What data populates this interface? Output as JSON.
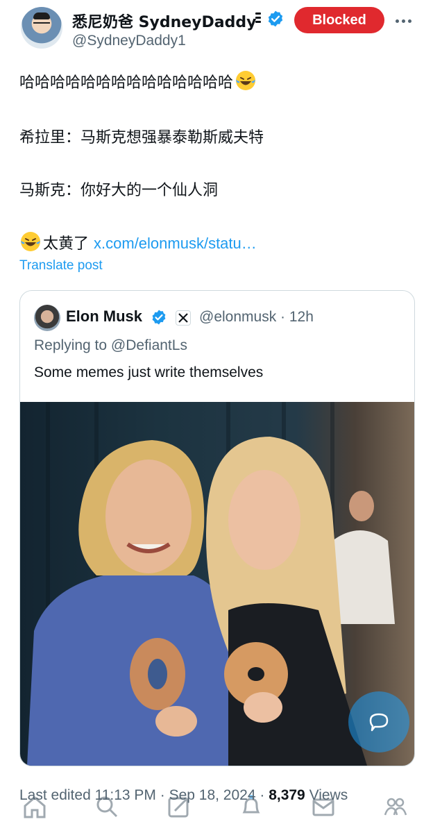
{
  "author": {
    "display_name": "悉尼奶爸 SydneyDaddy",
    "handle": "@SydneyDaddy1",
    "avatar_icon": "user-avatar",
    "verified_icon": "verified-badge-icon",
    "blocked_label": "Blocked",
    "more_icon": "more-options-icon"
  },
  "post": {
    "line1": "哈哈哈哈哈哈哈哈哈哈哈哈哈哈",
    "line2": "希拉里：马斯克想强暴泰勒斯威夫特",
    "line3": "马斯克：你好大的一个仙人洞",
    "line4_text": "太黄了",
    "line4_link": "x.com/elonmusk/statu…",
    "translate_label": "Translate post"
  },
  "quoted": {
    "name": "Elon Musk",
    "handle_time": "@elonmusk · 12h",
    "replying_prefix": "Replying to ",
    "replying_to": "@DefiantLs",
    "text": "Some memes just write themselves"
  },
  "footer": {
    "edited": "Last edited 11:13 PM · Sep 18, 2024 · ",
    "views_count": "8,379",
    "views_label": " Views"
  },
  "nav": [
    "home-icon",
    "search-icon",
    "compose-icon",
    "notifications-icon",
    "messages-icon",
    "communities-icon"
  ],
  "colors": {
    "accent": "#1d9bf0",
    "blocked": "#e0292e",
    "secondary_text": "#536471"
  }
}
